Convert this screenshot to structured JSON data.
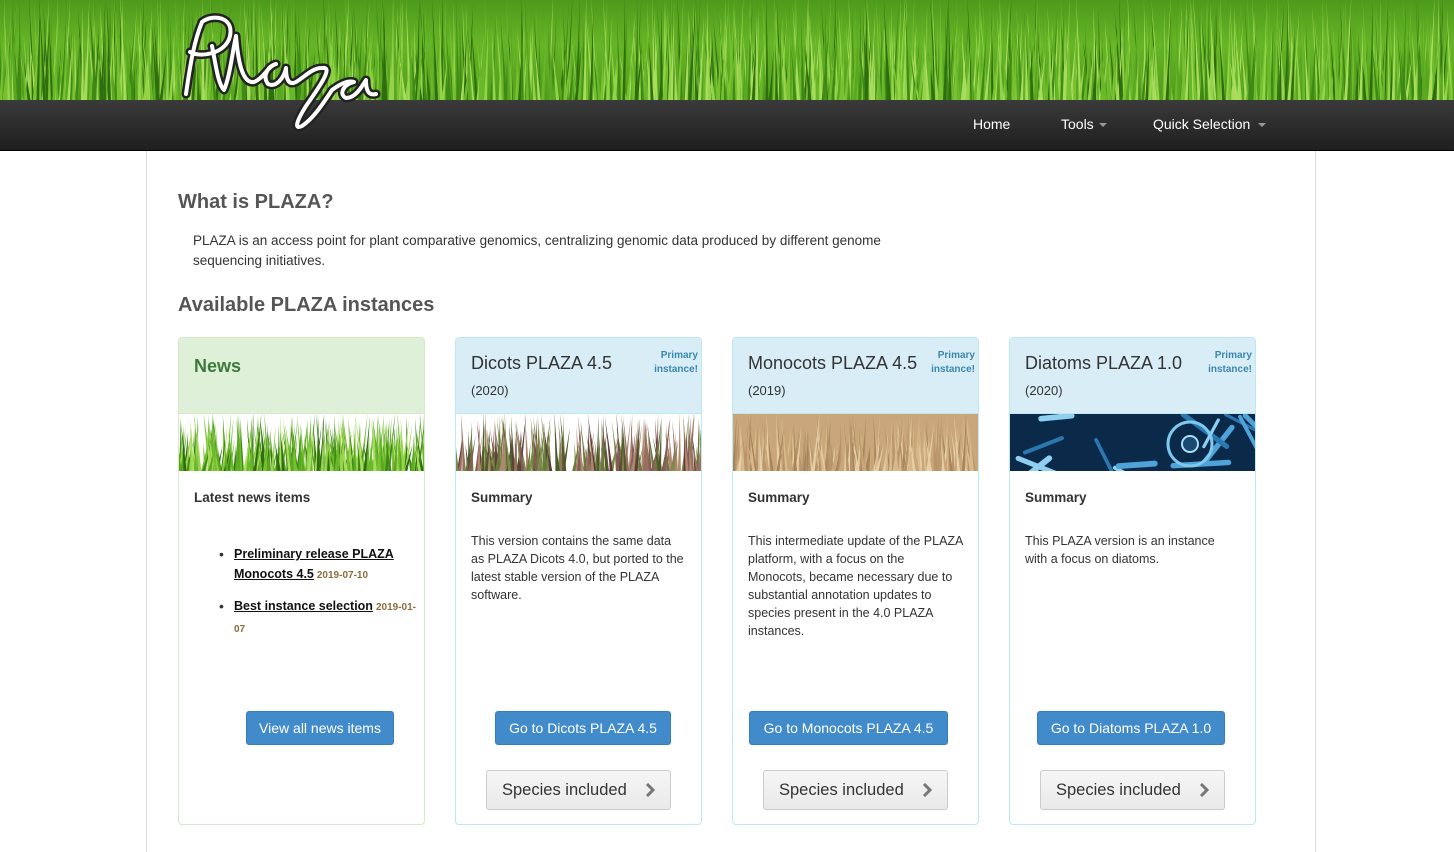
{
  "header": {
    "logo_text": "Plaza",
    "nav": {
      "home": "Home",
      "tools": "Tools",
      "quick_selection": "Quick Selection"
    }
  },
  "intro": {
    "title": "What is PLAZA?",
    "text": "PLAZA is an access point for plant comparative genomics, centralizing genomic data produced by different genome sequencing initiatives.",
    "instances_title": "Available PLAZA instances"
  },
  "news": {
    "title": "News",
    "subtitle": "Latest news items",
    "items": [
      {
        "label": "Preliminary release PLAZA Monocots 4.5",
        "date": "2019-07-10"
      },
      {
        "label": "Best instance selection",
        "date": "2019-01-07"
      }
    ],
    "button": "View all news items"
  },
  "instances": [
    {
      "title": "Dicots PLAZA 4.5",
      "year": "(2020)",
      "badge": "Primary instance!",
      "subtitle": "Summary",
      "description": "This version contains the same data as PLAZA Dicots 4.0, but ported to the latest stable version of the PLAZA software.",
      "button": "Go to Dicots PLAZA 4.5",
      "species_button": "Species included"
    },
    {
      "title": "Monocots PLAZA 4.5",
      "year": "(2019)",
      "badge": "Primary instance!",
      "subtitle": "Summary",
      "description": "This intermediate update of the PLAZA platform, with a focus on the Monocots, became necessary due to substantial annotation updates to species present in the 4.0 PLAZA instances.",
      "button": "Go to Monocots PLAZA 4.5",
      "species_button": "Species included"
    },
    {
      "title": "Diatoms PLAZA 1.0",
      "year": "(2020)",
      "badge": "Primary instance!",
      "subtitle": "Summary",
      "description": "This PLAZA version is an instance with a focus on diatoms.",
      "button": "Go to Diatoms PLAZA 1.0",
      "species_button": "Species included"
    }
  ],
  "colors": {
    "navbar": "#2a2a2a",
    "panel_info_bg": "#d9edf7",
    "panel_success_bg": "#dff0d8",
    "btn_primary": "#428bca",
    "badge_text": "#3a87ad"
  },
  "icons": [
    "plaza-logo",
    "chevron-right-icon",
    "caret-down-icon"
  ]
}
